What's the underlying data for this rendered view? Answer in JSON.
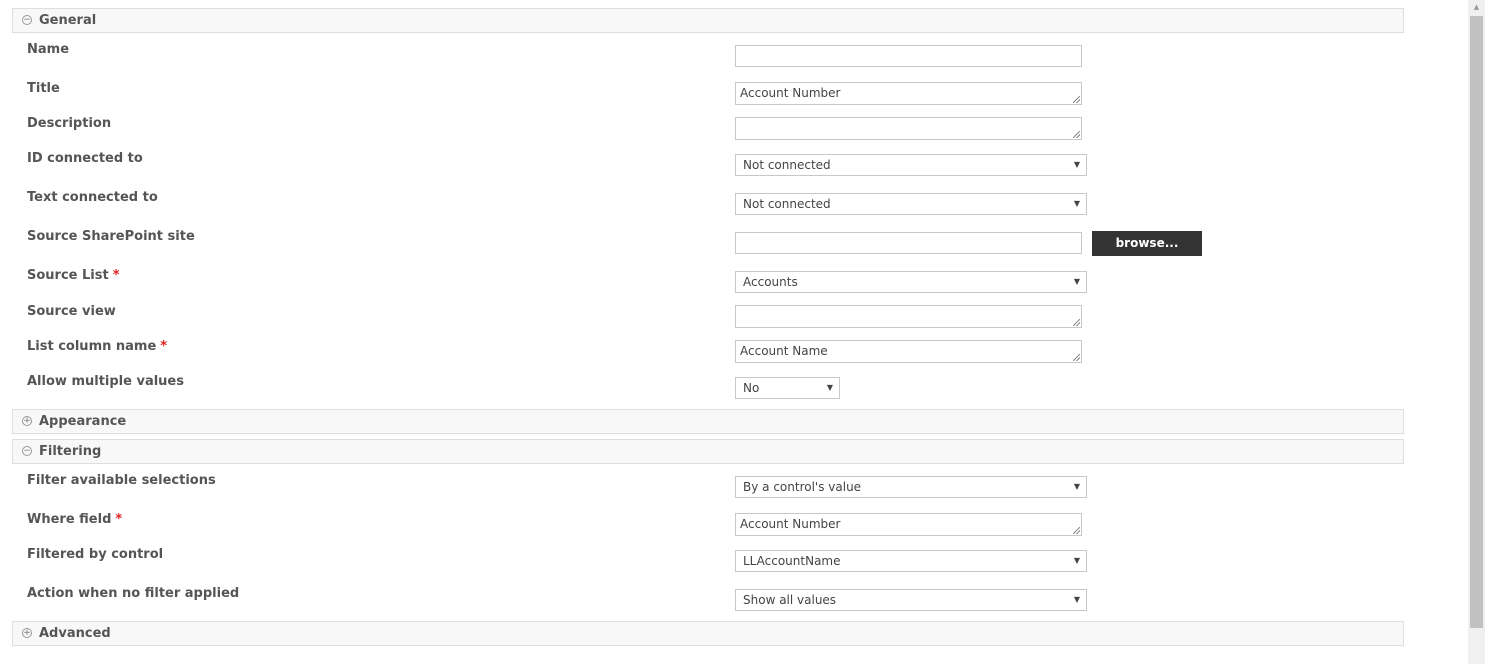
{
  "sections": {
    "general": {
      "title": "General",
      "toggle": "−"
    },
    "appearance": {
      "title": "Appearance",
      "toggle": "+"
    },
    "filtering": {
      "title": "Filtering",
      "toggle": "−"
    },
    "advanced": {
      "title": "Advanced",
      "toggle": "+"
    }
  },
  "general": {
    "name": {
      "label": "Name",
      "value": ""
    },
    "title": {
      "label": "Title",
      "value": "Account Number"
    },
    "description": {
      "label": "Description",
      "value": ""
    },
    "id_connected_to": {
      "label": "ID connected to",
      "value": "Not connected"
    },
    "text_connected_to": {
      "label": "Text connected to",
      "value": "Not connected"
    },
    "source_site": {
      "label": "Source SharePoint site",
      "value": "",
      "button": "browse..."
    },
    "source_list": {
      "label": "Source List",
      "required": "*",
      "value": "Accounts"
    },
    "source_view": {
      "label": "Source view",
      "value": ""
    },
    "list_column_name": {
      "label": "List column name",
      "required": "*",
      "value": "Account Name"
    },
    "allow_multiple": {
      "label": "Allow multiple values",
      "value": "No"
    }
  },
  "filtering": {
    "filter_available": {
      "label": "Filter available selections",
      "value": "By a control's value"
    },
    "where_field": {
      "label": "Where field",
      "required": "*",
      "value": "Account Number"
    },
    "filtered_by_control": {
      "label": "Filtered by control",
      "value": "LLAccountName"
    },
    "action_no_filter": {
      "label": "Action when no filter applied",
      "value": "Show all values"
    }
  },
  "icons": {
    "collapse": "collapse-icon",
    "expand": "expand-icon",
    "dropdown": "chevron-down-icon",
    "resize": "resize-grip-icon"
  },
  "colors": {
    "required": "#e02020",
    "button_bg": "#333333",
    "header_bg": "#f8f8f8"
  }
}
